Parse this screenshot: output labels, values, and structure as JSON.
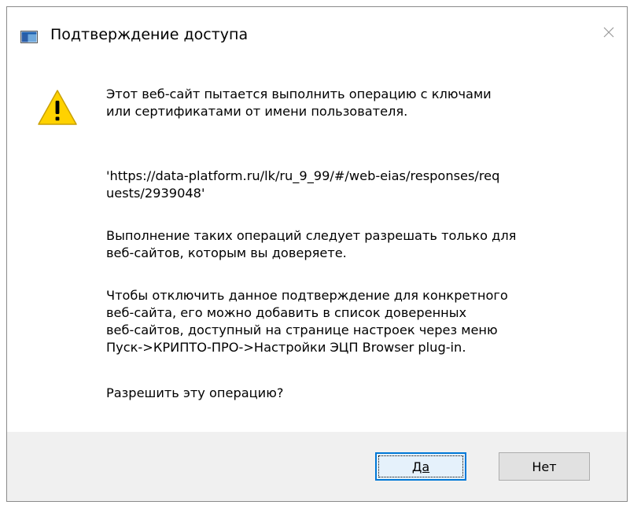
{
  "window": {
    "title": "Подтверждение доступа",
    "close_icon": "close-icon",
    "app_icon": "window-app-icon"
  },
  "message": {
    "warning_icon": "warning-icon",
    "intro_line1": "Этот веб-сайт пытается выполнить операцию с ключами",
    "intro_line2": "или сертификатами от имени пользователя.",
    "url_line1": "'https://data-platform.ru/lk/ru_9_99/#/web-eias/responses/req",
    "url_line2": "uests/2939048'",
    "warn_line1": "Выполнение таких операций следует разрешать только для",
    "warn_line2": "веб-сайтов, которым вы доверяете.",
    "howto_line1": "Чтобы отключить данное подтверждение для конкретного",
    "howto_line2": "веб-сайта, его можно добавить в список доверенных",
    "howto_line3": "веб-сайтов, доступный на странице настроек через меню",
    "howto_line4": "Пуск->КРИПТО-ПРО->Настройки ЭЦП Browser plug-in.",
    "question": "Разрешить эту операцию?"
  },
  "buttons": {
    "yes_label": "Да",
    "no_label": "Нет"
  },
  "colors": {
    "accent": "#0078d7",
    "warning_fill": "#ffd200",
    "footer_bg": "#f0f0f0"
  }
}
